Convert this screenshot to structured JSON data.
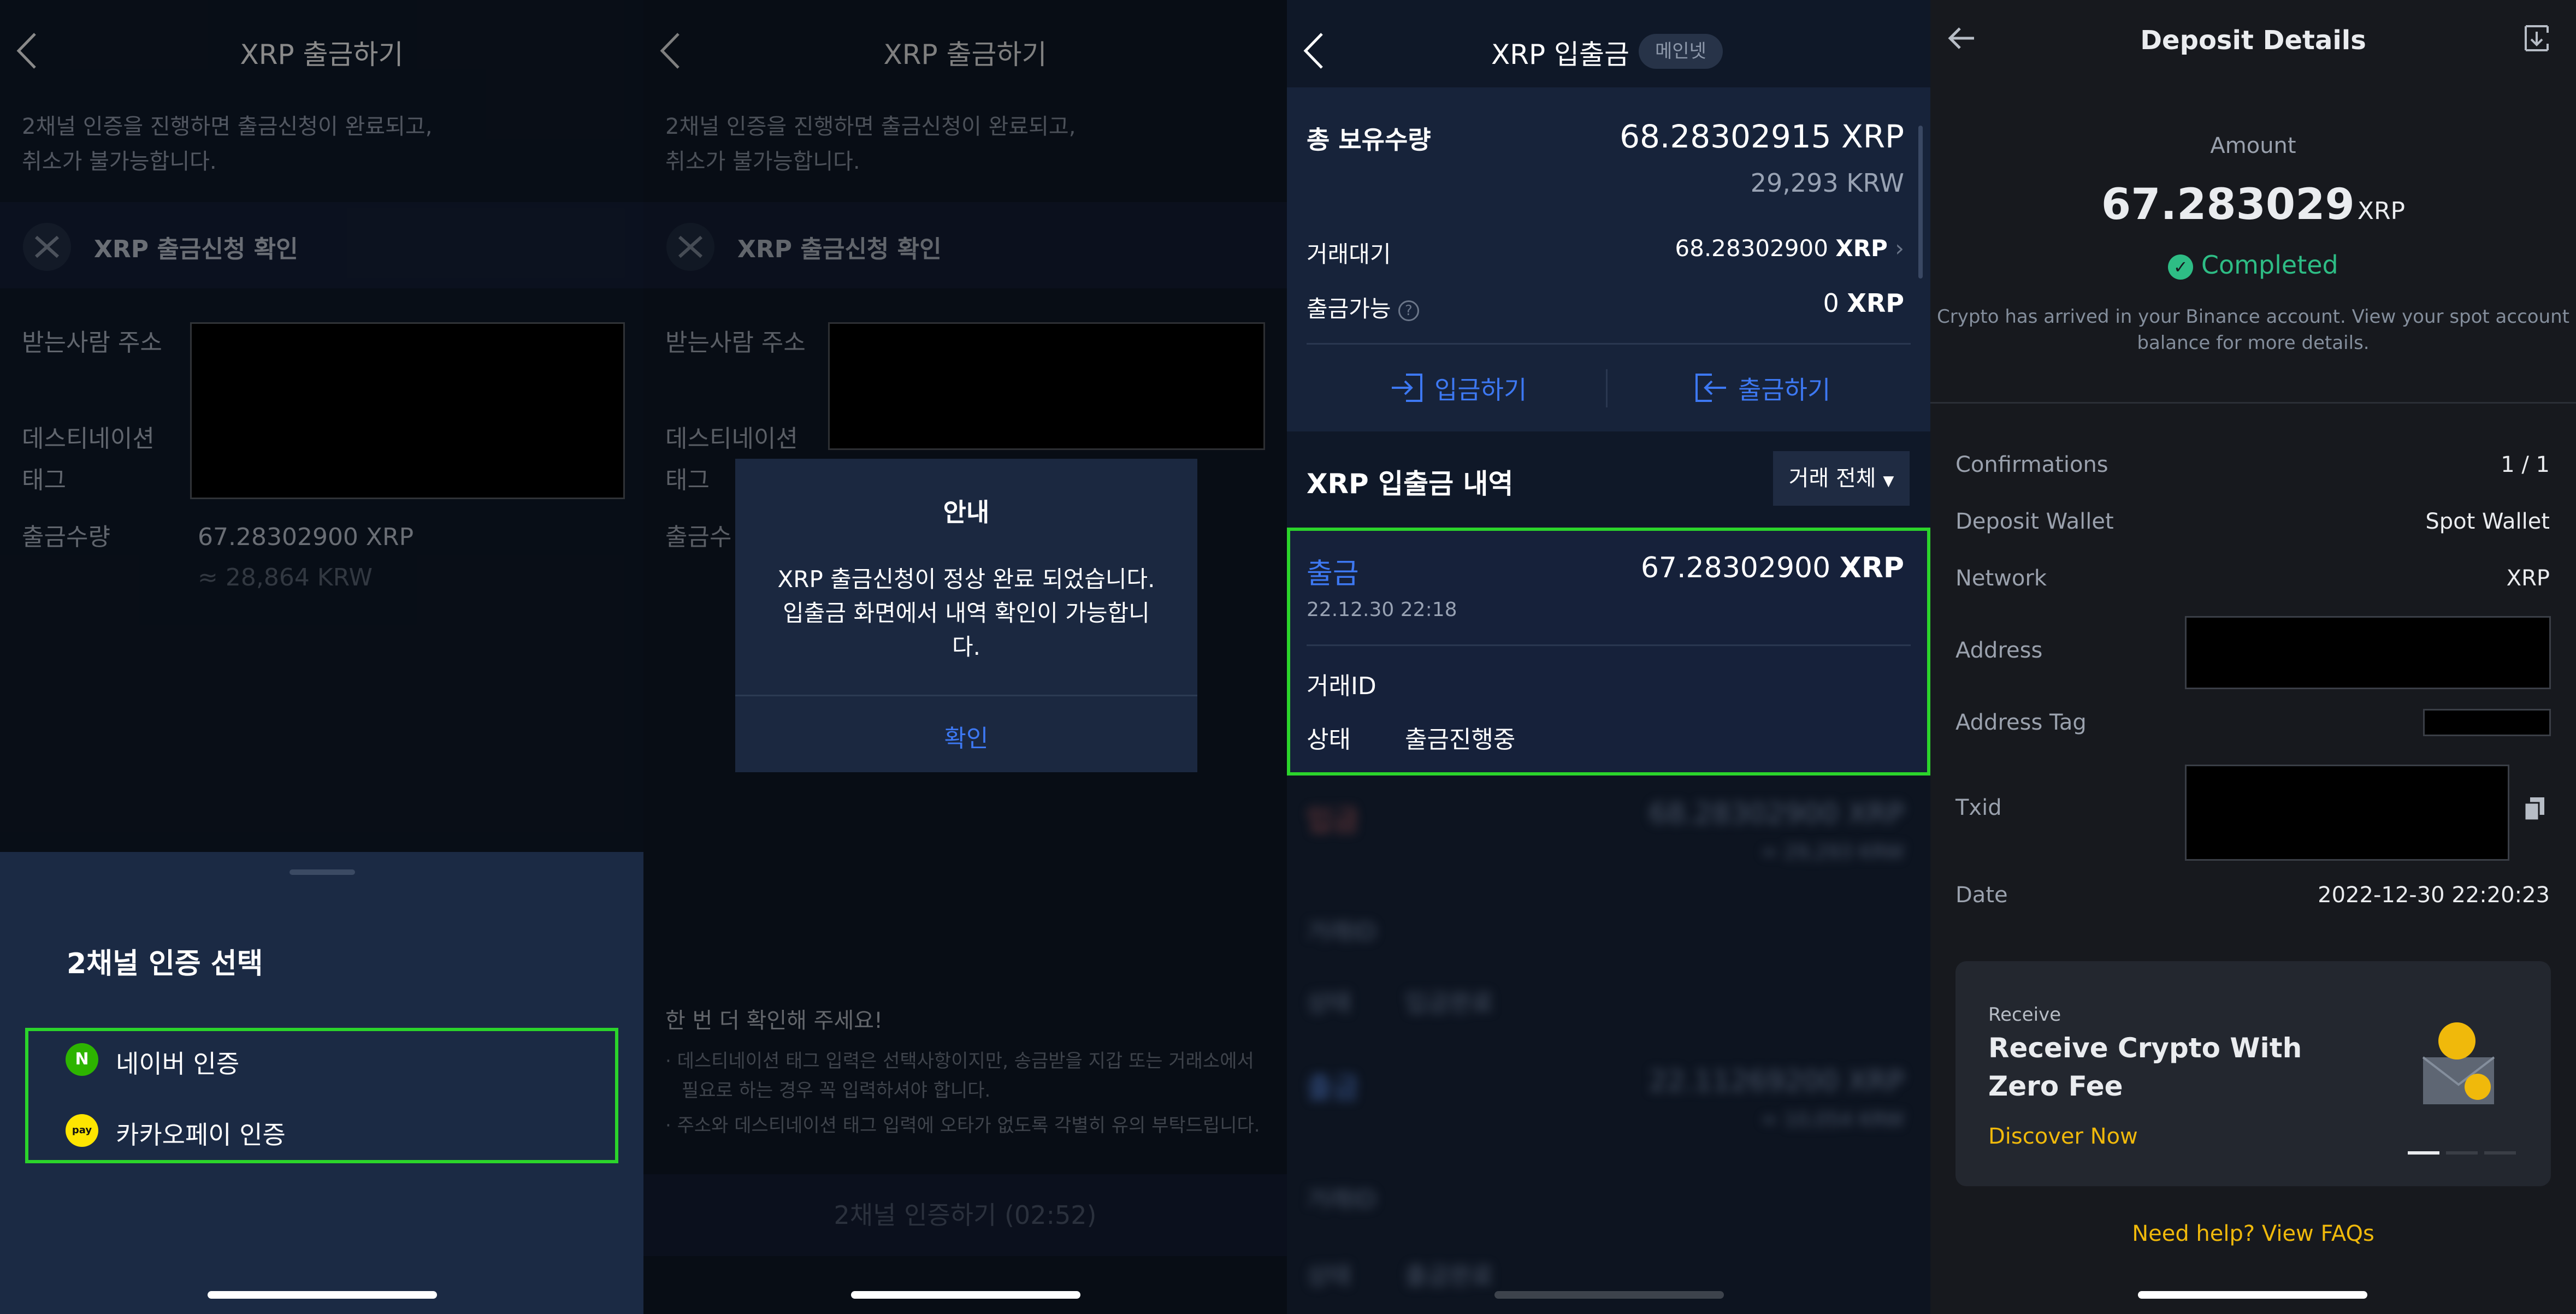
{
  "panel1": {
    "title": "XRP 출금하기",
    "notice_line1": "2채널 인증을 진행하면 출금신청이 완료되고,",
    "notice_line2": "취소가 불가능합니다.",
    "section_title": "XRP 출금신청 확인",
    "recipient_label": "받는사람 주소",
    "tag_label_line1": "데스티네이션",
    "tag_label_line2": "태그",
    "amount_label": "출금수량",
    "amount_value": "67.28302900 XRP",
    "amount_krw": "≈ 28,864 KRW",
    "sheet_title": "2채널 인증 선택",
    "auth_options": [
      {
        "label": "네이버 인증",
        "icon": "N",
        "color": "#2db400"
      },
      {
        "label": "카카오페이 인증",
        "icon": "pay",
        "color": "#fee500"
      }
    ]
  },
  "panel2": {
    "title": "XRP 출금하기",
    "notice_line1": "2채널 인증을 진행하면 출금신청이 완료되고,",
    "notice_line2": "취소가 불가능합니다.",
    "section_title": "XRP 출금신청 확인",
    "recipient_label": "받는사람 주소",
    "tag_label_line1": "데스티네이션",
    "tag_label_line2": "태그",
    "amount_label_partial": "출금수",
    "modal_title": "안내",
    "modal_line1": "XRP 출금신청이 정상 완료 되었습니다.",
    "modal_line2": "입출금 화면에서 내역 확인이 가능합니",
    "modal_line3": "다.",
    "modal_button": "확인",
    "note_title": "한 번 더 확인해 주세요!",
    "note_1a": "· 데스티네이션 태그 입력은 선택사항이지만, 송금받을 지갑 또는 거래소에서",
    "note_1b": "필요로 하는 경우 꼭 입력하셔야 합니다.",
    "note_2": "· 주소와 데스티네이션 태그 입력에 오타가 없도록 각별히 유의 부탁드립니다.",
    "auth_button": "2채널 인증하기 (02:52)"
  },
  "panel3": {
    "title": "XRP 입출금",
    "badge": "메인넷",
    "total_label": "총 보유수량",
    "total_value": "68.28302915 XRP",
    "total_krw": "29,293 KRW",
    "pending_label": "거래대기",
    "pending_value": "68.28302900",
    "pending_unit": "XRP",
    "available_label": "출금가능",
    "available_value": "0",
    "available_unit": "XRP",
    "deposit_button": "입금하기",
    "withdraw_button": "출금하기",
    "history_title": "XRP 입출금 내역",
    "filter_label": "거래 전체",
    "tx": {
      "type": "출금",
      "amount": "67.28302900",
      "unit": "XRP",
      "datetime": "22.12.30 22:18",
      "id_label": "거래ID",
      "status_label": "상태",
      "status_value": "출금진행중"
    },
    "blurred": [
      {
        "type": "입금",
        "amount": "68.28302900 XRP",
        "krw": "≈ 29,293 KRW",
        "id_label": "거래ID",
        "status_label": "상태",
        "status_value": "입금완료"
      },
      {
        "type": "출금",
        "amount": "22.11269200 XRP",
        "krw": "≈ 10,054 KRW",
        "id_label": "거래ID",
        "status_label": "상태",
        "status_value": "출금완료"
      }
    ]
  },
  "panel4": {
    "title": "Deposit Details",
    "amount_label": "Amount",
    "amount_value": "67.283029",
    "amount_unit": "XRP",
    "status": "Completed",
    "status_color": "#2ebd85",
    "info_line1": "Crypto has arrived in your Binance account. View your spot account",
    "info_line2": "balance for more details.",
    "rows": {
      "confirmations_label": "Confirmations",
      "confirmations_value": "1 / 1",
      "wallet_label": "Deposit Wallet",
      "wallet_value": "Spot Wallet",
      "network_label": "Network",
      "network_value": "XRP",
      "address_label": "Address",
      "tag_label": "Address Tag",
      "txid_label": "Txid",
      "date_label": "Date",
      "date_value": "2022-12-30 22:20:23"
    },
    "promo": {
      "eyebrow": "Receive",
      "title_line1": "Receive Crypto With",
      "title_line2": "Zero Fee",
      "link": "Discover Now"
    },
    "help_link": "Need help? View FAQs",
    "accent": "#f0b90b"
  }
}
